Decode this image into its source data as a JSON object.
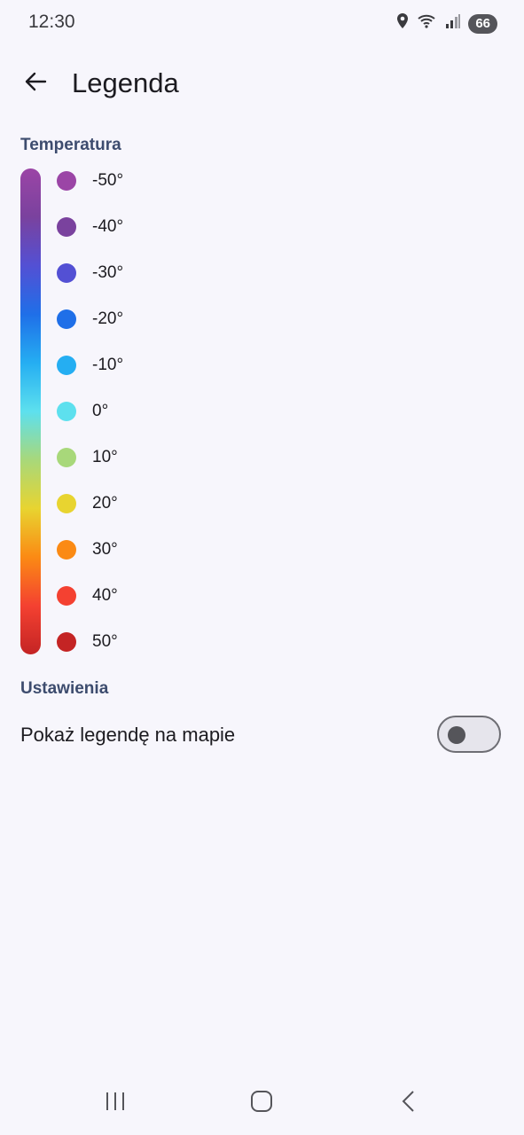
{
  "status_bar": {
    "time": "12:30",
    "battery": "66",
    "icons": [
      "location-icon",
      "wifi-icon",
      "signal-icon"
    ]
  },
  "app_bar": {
    "title": "Legenda",
    "back_icon": "arrow-left-icon"
  },
  "temperature_section": {
    "title": "Temperatura",
    "items": [
      {
        "label": "-50°",
        "color": "#9b45a6"
      },
      {
        "label": "-40°",
        "color": "#7a429e"
      },
      {
        "label": "-30°",
        "color": "#5350d4"
      },
      {
        "label": "-20°",
        "color": "#1f6fe8"
      },
      {
        "label": "-10°",
        "color": "#25aef2"
      },
      {
        "label": "0°",
        "color": "#5de0ee"
      },
      {
        "label": "10°",
        "color": "#a8d87a"
      },
      {
        "label": "20°",
        "color": "#e8d430"
      },
      {
        "label": "30°",
        "color": "#fb8a14"
      },
      {
        "label": "40°",
        "color": "#f44131"
      },
      {
        "label": "50°",
        "color": "#c42424"
      }
    ]
  },
  "settings_section": {
    "title": "Ustawienia",
    "show_legend_label": "Pokaż legendę na mapie",
    "show_legend_on": false
  },
  "nav_bar": {
    "icons": [
      "recent-apps-icon",
      "home-icon",
      "back-icon"
    ]
  }
}
